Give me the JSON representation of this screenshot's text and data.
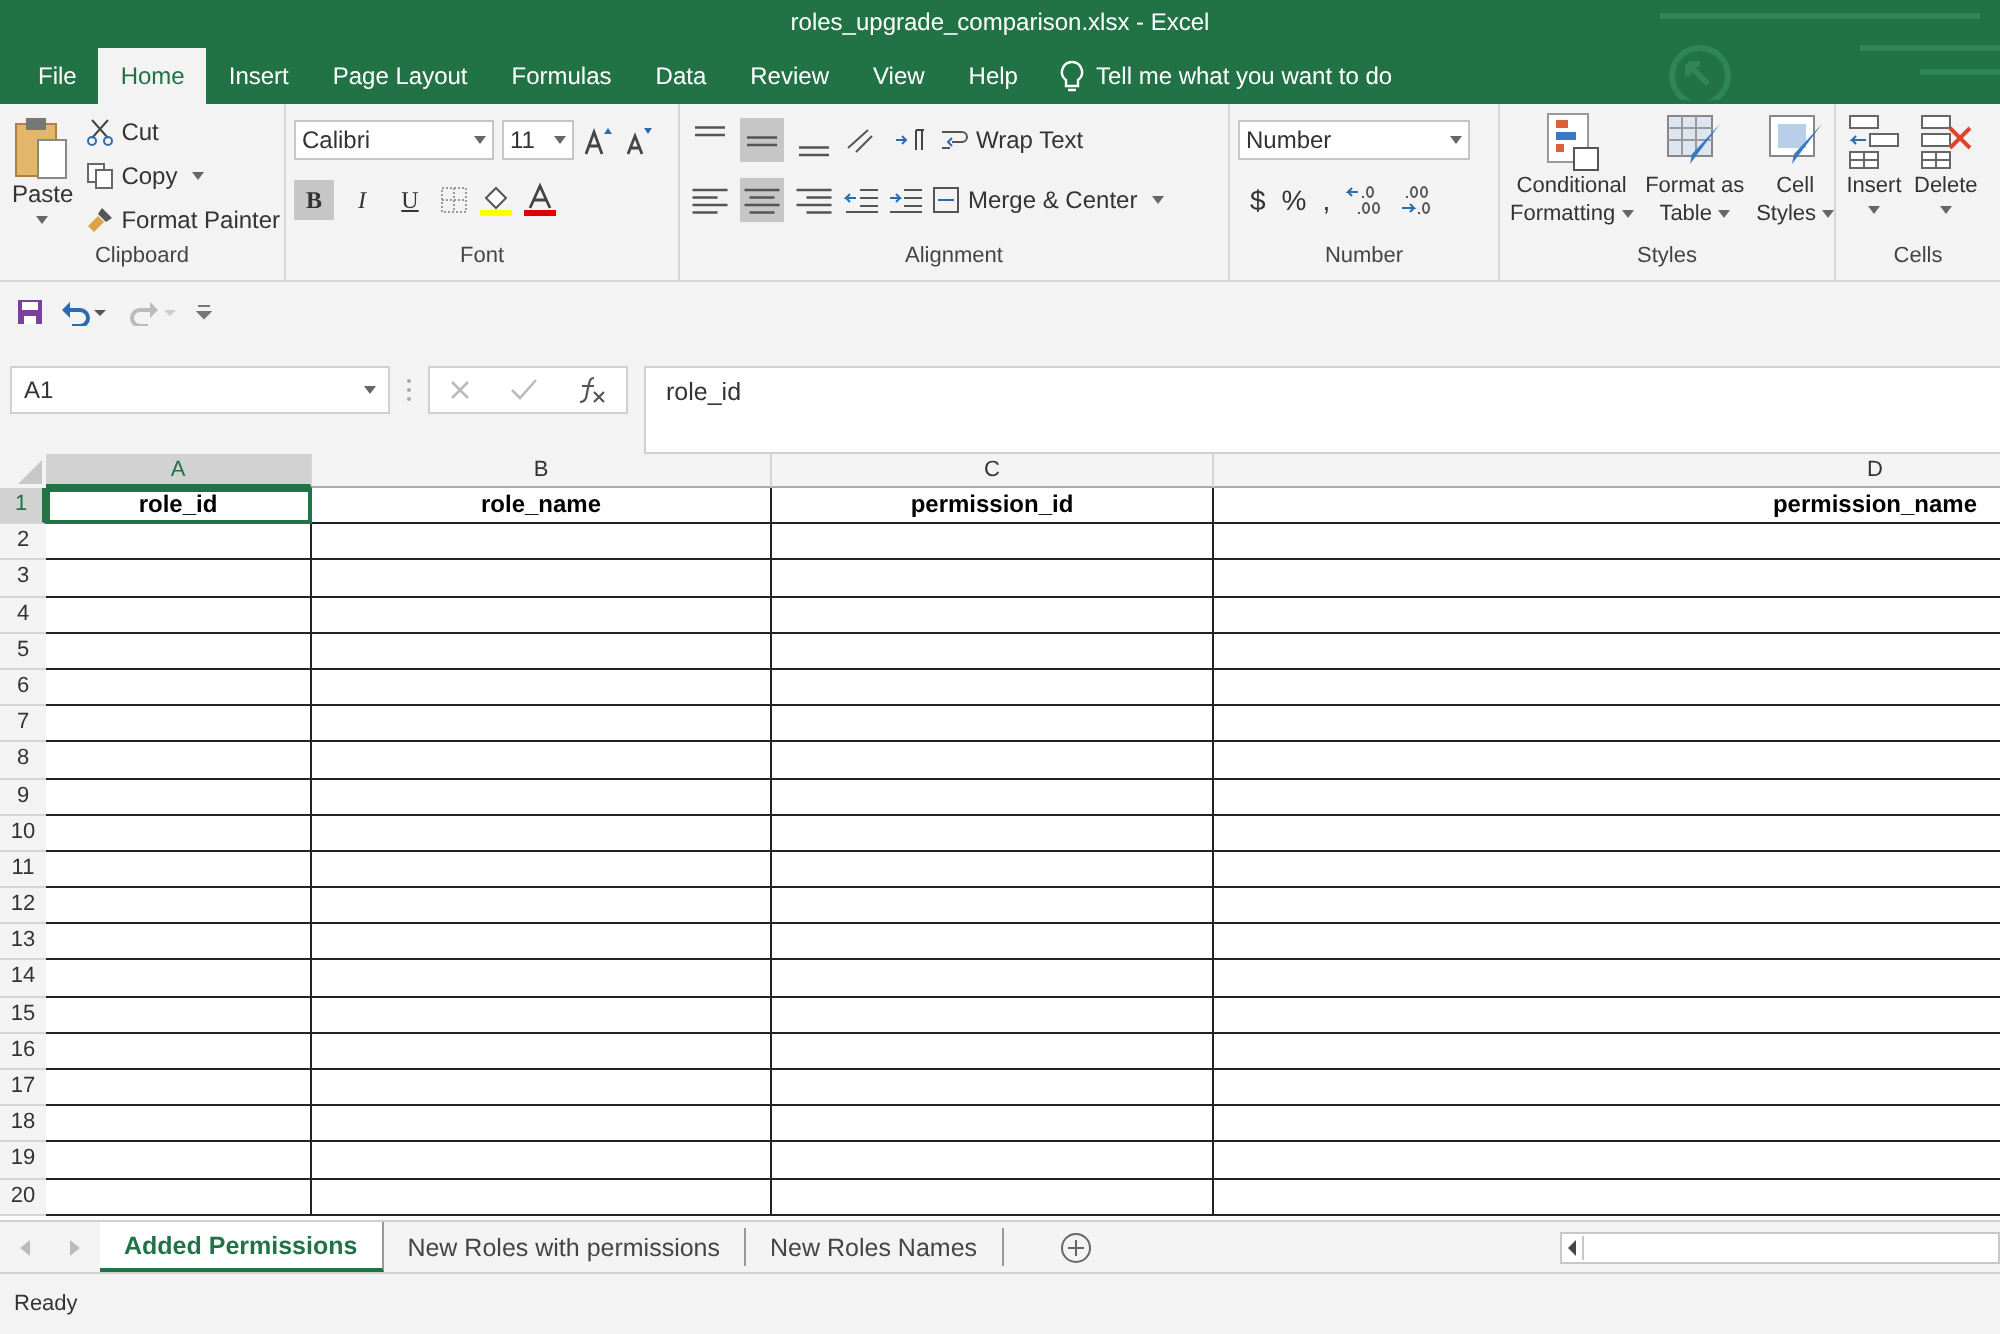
{
  "window": {
    "title": "roles_upgrade_comparison.xlsx  -  Excel"
  },
  "ribbon_tabs": [
    {
      "label": "File",
      "selected": false
    },
    {
      "label": "Home",
      "selected": true
    },
    {
      "label": "Insert",
      "selected": false
    },
    {
      "label": "Page Layout",
      "selected": false
    },
    {
      "label": "Formulas",
      "selected": false
    },
    {
      "label": "Data",
      "selected": false
    },
    {
      "label": "Review",
      "selected": false
    },
    {
      "label": "View",
      "selected": false
    },
    {
      "label": "Help",
      "selected": false
    }
  ],
  "tell_me": {
    "placeholder": "Tell me what you want to do"
  },
  "clipboard": {
    "label": "Clipboard",
    "paste": "Paste",
    "cut": "Cut",
    "copy": "Copy",
    "format_painter": "Format Painter"
  },
  "font": {
    "label": "Font",
    "font_name": "Calibri",
    "font_size": "11",
    "styles": [
      {
        "label": "B",
        "kind": "bold",
        "pressed": true
      },
      {
        "label": "I",
        "kind": "italic",
        "pressed": false
      },
      {
        "label": "U",
        "kind": "underline",
        "pressed": false
      }
    ]
  },
  "alignment": {
    "label": "Alignment",
    "vertical": [
      {
        "kind": "top",
        "pressed": false
      },
      {
        "kind": "middle",
        "pressed": true
      },
      {
        "kind": "bottom",
        "pressed": false
      }
    ],
    "horizontal": [
      {
        "kind": "left",
        "pressed": false
      },
      {
        "kind": "center",
        "pressed": true
      },
      {
        "kind": "right",
        "pressed": false
      }
    ],
    "wrap_text": "Wrap Text",
    "merge_center": "Merge & Center"
  },
  "number": {
    "label": "Number",
    "format": "Number",
    "symbols": [
      "$",
      "%",
      ","
    ]
  },
  "styles": {
    "label": "Styles",
    "buttons": [
      {
        "kind": "conditional",
        "line1": "Conditional",
        "line2": "Formatting"
      },
      {
        "kind": "table",
        "line1": "Format as",
        "line2": "Table"
      },
      {
        "kind": "cell",
        "line1": "Cell",
        "line2": "Styles"
      }
    ]
  },
  "cells": {
    "label": "Cells",
    "buttons": [
      {
        "kind": "insert",
        "label": "Insert"
      },
      {
        "kind": "delete",
        "label": "Delete"
      }
    ]
  },
  "name_box": "A1",
  "formula": "role_id",
  "columns": [
    {
      "letter": "A",
      "selected": true
    },
    {
      "letter": "B",
      "selected": false
    },
    {
      "letter": "C",
      "selected": false
    },
    {
      "letter": "D",
      "selected": false
    }
  ],
  "rows": [
    {
      "number": "1",
      "selected": true,
      "cells": [
        "role_id",
        "role_name",
        "permission_id",
        "permission_name"
      ]
    },
    {
      "number": "2",
      "selected": false
    },
    {
      "number": "3",
      "selected": false
    },
    {
      "number": "4",
      "selected": false
    },
    {
      "number": "5",
      "selected": false
    },
    {
      "number": "6",
      "selected": false
    },
    {
      "number": "7",
      "selected": false
    },
    {
      "number": "8",
      "selected": false
    },
    {
      "number": "9",
      "selected": false
    },
    {
      "number": "10",
      "selected": false
    },
    {
      "number": "11",
      "selected": false
    },
    {
      "number": "12",
      "selected": false
    },
    {
      "number": "13",
      "selected": false
    },
    {
      "number": "14",
      "selected": false
    },
    {
      "number": "15",
      "selected": false
    },
    {
      "number": "16",
      "selected": false
    },
    {
      "number": "17",
      "selected": false
    },
    {
      "number": "18",
      "selected": false
    },
    {
      "number": "19",
      "selected": false
    },
    {
      "number": "20",
      "selected": false
    }
  ],
  "sheets": [
    {
      "label": "Added Permissions",
      "selected": true
    },
    {
      "label": "New Roles with permissions",
      "selected": false
    },
    {
      "label": "New Roles Names",
      "selected": false
    }
  ],
  "status_bar": {
    "text": "Ready"
  }
}
